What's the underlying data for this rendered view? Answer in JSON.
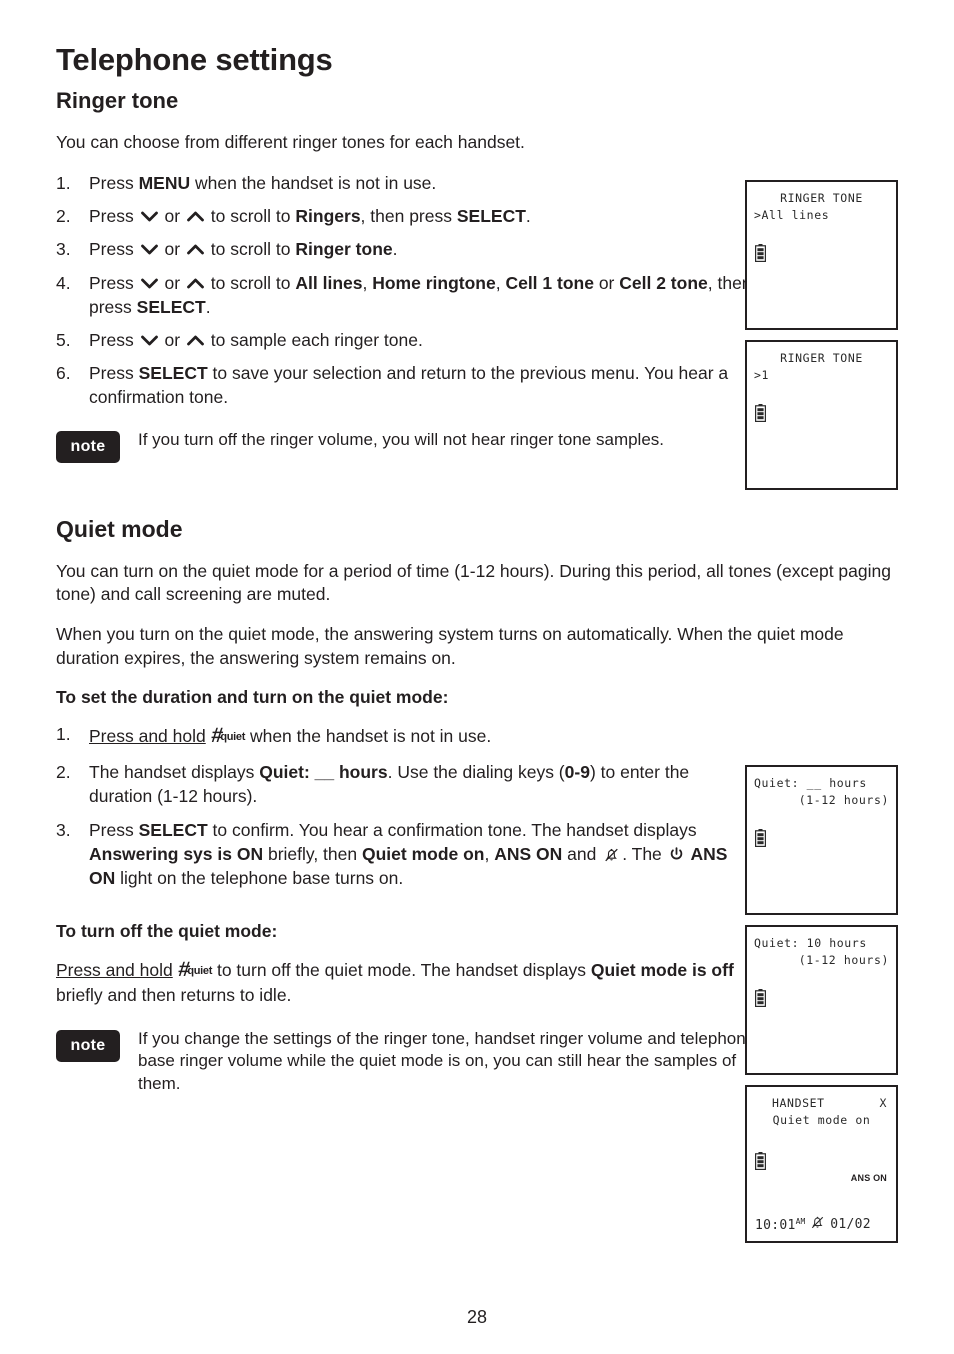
{
  "chapter_title": "Telephone settings",
  "ringer": {
    "heading": "Ringer tone",
    "intro": "You can choose from different ringer tones for each handset.",
    "steps": [
      {
        "num": "1.",
        "parts": [
          {
            "t": "text",
            "v": "Press "
          },
          {
            "t": "bold",
            "v": "MENU"
          },
          {
            "t": "text",
            "v": " when the handset is not in use."
          }
        ]
      },
      {
        "num": "2.",
        "parts": [
          {
            "t": "text",
            "v": "Press "
          },
          {
            "t": "icon",
            "v": "chevron-down-icon"
          },
          {
            "t": "text",
            "v": " or "
          },
          {
            "t": "icon",
            "v": "chevron-up-icon"
          },
          {
            "t": "text",
            "v": " to scroll to "
          },
          {
            "t": "bold",
            "v": "Ringers"
          },
          {
            "t": "text",
            "v": ", then press "
          },
          {
            "t": "bold",
            "v": "SELECT"
          },
          {
            "t": "text",
            "v": "."
          }
        ]
      },
      {
        "num": "3.",
        "parts": [
          {
            "t": "text",
            "v": "Press "
          },
          {
            "t": "icon",
            "v": "chevron-down-icon"
          },
          {
            "t": "text",
            "v": " or "
          },
          {
            "t": "icon",
            "v": "chevron-up-icon"
          },
          {
            "t": "text",
            "v": " to scroll to "
          },
          {
            "t": "bold",
            "v": "Ringer tone"
          },
          {
            "t": "text",
            "v": "."
          }
        ]
      },
      {
        "num": "4.",
        "parts": [
          {
            "t": "text",
            "v": "Press "
          },
          {
            "t": "icon",
            "v": "chevron-down-icon"
          },
          {
            "t": "text",
            "v": " or "
          },
          {
            "t": "icon",
            "v": "chevron-up-icon"
          },
          {
            "t": "text",
            "v": " to scroll to "
          },
          {
            "t": "bold",
            "v": "All lines"
          },
          {
            "t": "text",
            "v": ", "
          },
          {
            "t": "bold",
            "v": "Home ringtone"
          },
          {
            "t": "text",
            "v": ", "
          },
          {
            "t": "bold",
            "v": "Cell 1 tone"
          },
          {
            "t": "text",
            "v": " or "
          },
          {
            "t": "bold",
            "v": "Cell 2 tone"
          },
          {
            "t": "text",
            "v": ", then press "
          },
          {
            "t": "bold",
            "v": "SELECT"
          },
          {
            "t": "text",
            "v": "."
          }
        ]
      },
      {
        "num": "5.",
        "parts": [
          {
            "t": "text",
            "v": "Press "
          },
          {
            "t": "icon",
            "v": "chevron-down-icon"
          },
          {
            "t": "text",
            "v": " or "
          },
          {
            "t": "icon",
            "v": "chevron-up-icon"
          },
          {
            "t": "text",
            "v": " to sample each ringer tone."
          }
        ]
      },
      {
        "num": "6.",
        "parts": [
          {
            "t": "text",
            "v": "Press "
          },
          {
            "t": "bold",
            "v": "SELECT"
          },
          {
            "t": "text",
            "v": " to save your selection and return to the previous menu. You hear a confirmation tone."
          }
        ]
      }
    ],
    "note_badge": "note",
    "note_text": "If you turn off the ringer volume, you will not hear ringer tone samples."
  },
  "quiet": {
    "heading": "Quiet mode",
    "para1": "You can turn on the quiet mode for a period of time (1-12 hours). During this period, all tones (except paging tone) and call screening are muted.",
    "para2": "When you turn on the quiet mode, the answering system turns on automatically. When the quiet mode duration expires, the answering system remains on.",
    "set_heading": "To set the duration and turn on the quiet mode:",
    "set_steps": [
      {
        "num": "1.",
        "parts": [
          {
            "t": "underline",
            "v": "Press and hold"
          },
          {
            "t": "text",
            "v": " "
          },
          {
            "t": "key",
            "v": "#",
            "sub": "quiet"
          },
          {
            "t": "text",
            "v": " when the handset is not in use."
          }
        ]
      },
      {
        "num": "2.",
        "parts": [
          {
            "t": "text",
            "v": "The handset displays "
          },
          {
            "t": "bold",
            "v": "Quiet: __ hours"
          },
          {
            "t": "text",
            "v": ". Use the dialing keys ("
          },
          {
            "t": "bold",
            "v": "0-9"
          },
          {
            "t": "text",
            "v": ") to enter the duration (1-12 hours)."
          }
        ]
      },
      {
        "num": "3.",
        "parts": [
          {
            "t": "text",
            "v": "Press "
          },
          {
            "t": "bold",
            "v": "SELECT"
          },
          {
            "t": "text",
            "v": " to confirm. You hear a confirmation tone. The handset displays "
          },
          {
            "t": "bold",
            "v": "Answering sys is ON"
          },
          {
            "t": "text",
            "v": " briefly, then "
          },
          {
            "t": "bold",
            "v": "Quiet mode on"
          },
          {
            "t": "text",
            "v": ", "
          },
          {
            "t": "bold",
            "v": "ANS ON"
          },
          {
            "t": "text",
            "v": " and "
          },
          {
            "t": "icon",
            "v": "bell-muted-icon"
          },
          {
            "t": "text",
            "v": ". The "
          },
          {
            "t": "icon",
            "v": "power-icon"
          },
          {
            "t": "text",
            "v": " "
          },
          {
            "t": "bold",
            "v": "ANS ON"
          },
          {
            "t": "text",
            "v": " light on the telephone base turns on."
          }
        ]
      }
    ],
    "off_heading": "To turn off the quiet mode:",
    "off_parts": [
      {
        "t": "underline",
        "v": "Press and hold"
      },
      {
        "t": "text",
        "v": " "
      },
      {
        "t": "key",
        "v": "#",
        "sub": "quiet"
      },
      {
        "t": "text",
        "v": " to turn off the quiet mode. The handset displays "
      },
      {
        "t": "bold",
        "v": "Quiet mode is off"
      },
      {
        "t": "text",
        "v": " briefly and then returns to idle."
      }
    ],
    "note_badge": "note",
    "note_text": "If you change the settings of the ringer tone, handset ringer volume and telephone base ringer volume while the quiet mode is on, you can still hear the samples of them."
  },
  "screens": [
    {
      "id": "ringer-tone-all-lines",
      "line1": "RINGER TONE",
      "line1_align": "center",
      "line2": ">All lines",
      "line2_align": "left",
      "battery": "battery-icon"
    },
    {
      "id": "ringer-tone-1",
      "line1": "RINGER TONE",
      "line1_align": "center",
      "line2": ">1",
      "line2_align": "left",
      "battery": "battery-icon"
    },
    {
      "id": "quiet-hours-blank",
      "line1": "Quiet: __ hours",
      "line1_align": "left",
      "line2": "(1-12 hours)",
      "line2_align": "right",
      "battery": "battery-icon"
    },
    {
      "id": "quiet-hours-10",
      "line1": "Quiet: 10 hours",
      "line1_align": "left",
      "line2": "(1-12 hours)",
      "line2_align": "right",
      "battery": "battery-icon"
    }
  ],
  "idle_screen": {
    "id": "handset-quiet-mode-on",
    "title": "HANDSET",
    "corner": "X",
    "status": "Quiet mode on",
    "ans_on": "ANS ON",
    "time": "10:01",
    "ampm": "AM",
    "date": "01/02",
    "battery": "battery-icon",
    "mute_icon": "bell-muted-icon"
  },
  "footer": {
    "page_number": "28"
  },
  "colors": {
    "ink": "#231f20",
    "lcd_text": "#2a2a2a",
    "badge_bg": "#231f20"
  }
}
